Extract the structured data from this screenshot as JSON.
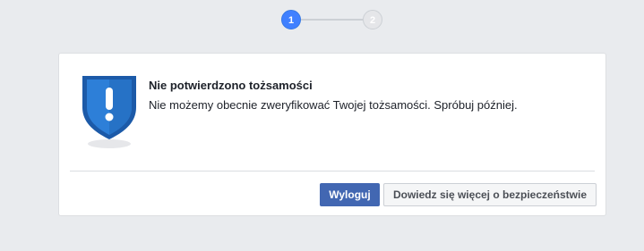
{
  "stepper": {
    "step1": "1",
    "step2": "2",
    "current_step": 1
  },
  "dialog": {
    "icon": "shield-warning-icon",
    "title": "Nie potwierdzono tożsamości",
    "message": "Nie możemy obecnie zweryfikować Twojej tożsamości. Spróbuj później.",
    "buttons": {
      "logout_label": "Wyloguj",
      "learn_more_label": "Dowiedz się więcej o bezpieczeństwie"
    }
  },
  "colors": {
    "page_background": "#e9ebee",
    "accent": "#4267b2",
    "active_step": "#4080ff",
    "shield_dark": "#1c5aa8",
    "shield_light": "#2d7fd8"
  }
}
